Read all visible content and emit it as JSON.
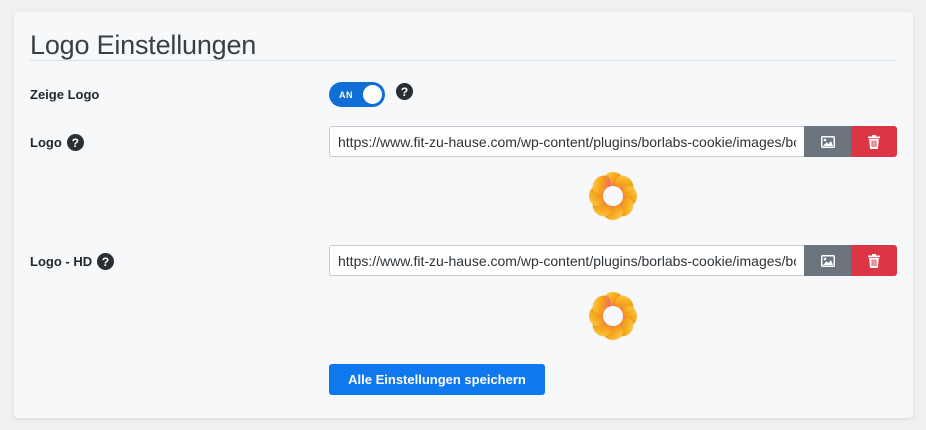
{
  "panel": {
    "title": "Logo Einstellungen"
  },
  "show_logo": {
    "label": "Zeige Logo",
    "toggle_text": "AN",
    "help_glyph": "?"
  },
  "logo": {
    "label": "Logo",
    "help_glyph": "?",
    "value": "https://www.fit-zu-hause.com/wp-content/plugins/borlabs-cookie/images/borlabs-cookie-logo.svg",
    "preview_icon": "borlabs-cookie-logo"
  },
  "logo_hd": {
    "label": "Logo - HD",
    "help_glyph": "?",
    "value": "https://www.fit-zu-hause.com/wp-content/plugins/borlabs-cookie/images/borlabs-cookie-logo.svg",
    "preview_icon": "borlabs-cookie-logo"
  },
  "actions": {
    "save_label": "Alle Einstellungen speichern"
  },
  "colors": {
    "toggle_on": "#0f6fd6",
    "media_button": "#6c757d",
    "delete_button": "#dc3545",
    "primary_button": "#0f78ef"
  },
  "icons": {
    "media": "image-icon",
    "delete": "trash-icon",
    "help": "question-circle-icon"
  }
}
